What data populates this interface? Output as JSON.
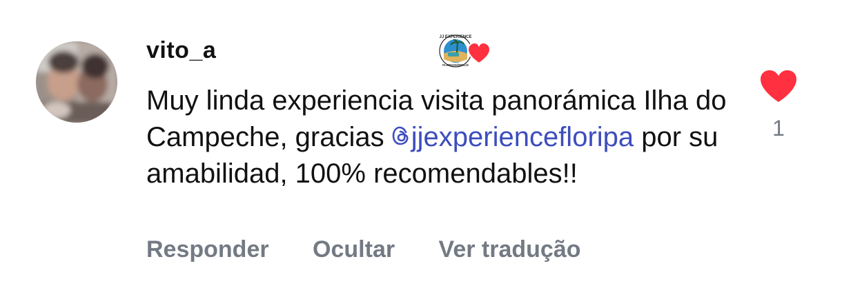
{
  "comment": {
    "username": "vito_a",
    "text_before_mention": "Muy linda experiencia visita panorámica Ilha do Campeche, gracias ",
    "mention": "jjexperiencefloripa",
    "text_after_mention": " por su amabilidad, 100% recomendables!!",
    "like_count": "1"
  },
  "creator_badge": {
    "brand_top": "JJ EXPERIENCE",
    "brand_bottom": "FLORIANÓPOLIS"
  },
  "actions": {
    "reply_label": "Responder",
    "hide_label": "Ocultar",
    "translate_label": "Ver tradução"
  },
  "icons": {
    "like": "heart-icon",
    "mention": "threads-icon",
    "creator_heart": "heart-icon"
  },
  "colors": {
    "like_red": "#ff3040",
    "mention_blue": "#3d4dbd",
    "muted_gray": "#737a84"
  }
}
